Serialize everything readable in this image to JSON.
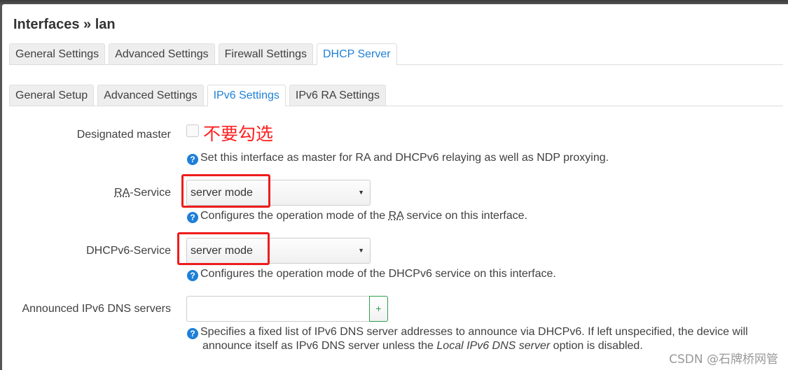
{
  "page": {
    "title": "Interfaces » lan"
  },
  "main_tabs": [
    {
      "label": "General Settings",
      "active": false
    },
    {
      "label": "Advanced Settings",
      "active": false
    },
    {
      "label": "Firewall Settings",
      "active": false
    },
    {
      "label": "DHCP Server",
      "active": true
    }
  ],
  "sub_tabs": [
    {
      "label": "General Setup",
      "active": false
    },
    {
      "label": "Advanced Settings",
      "active": false
    },
    {
      "label": "IPv6 Settings",
      "active": true
    },
    {
      "label": "IPv6 RA Settings",
      "active": false
    }
  ],
  "fields": {
    "designated_master": {
      "label": "Designated master",
      "checked": false,
      "help": "Set this interface as master for RA and DHCPv6 relaying as well as NDP proxying.",
      "annotation": "不要勾选"
    },
    "ra_service": {
      "label_abbr": "RA",
      "label_rest": "-Service",
      "value": "server mode",
      "help_pre": "Configures the operation mode of the ",
      "help_abbr": "RA",
      "help_post": " service on this interface."
    },
    "dhcpv6_service": {
      "label": "DHCPv6-Service",
      "value": "server mode",
      "help": "Configures the operation mode of the DHCPv6 service on this interface."
    },
    "dns_servers": {
      "label": "Announced IPv6 DNS servers",
      "value": "",
      "add_label": "+",
      "help_line1": "Specifies a fixed list of IPv6 DNS server addresses to announce via DHCPv6. If left unspecified, the device will",
      "help_line2_pre": "announce itself as IPv6 DNS server unless the ",
      "help_line2_em": "Local IPv6 DNS server",
      "help_line2_post": " option is disabled."
    }
  },
  "help_icon_glyph": "?",
  "caret_glyph": "▼",
  "watermark": "CSDN @石牌桥网管",
  "colors": {
    "accent": "#1e7fd8",
    "annotation_red": "#ee1c1c",
    "add_green": "#2e9e4e"
  }
}
